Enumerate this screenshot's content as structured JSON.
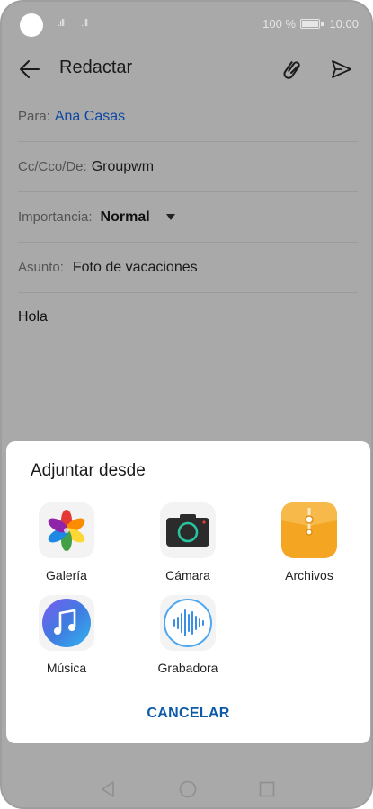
{
  "status_bar": {
    "signal1": ".ıll",
    "signal2": ".ıll",
    "battery": "100 %",
    "time": "10:00"
  },
  "app_bar": {
    "title": "Redactar",
    "icons": [
      "back-arrow-icon",
      "paperclip-icon",
      "send-icon"
    ]
  },
  "form": {
    "to_label": "Para:",
    "to_value": "Ana Casas",
    "cc_label": "Cc/Cco/De:",
    "cc_value": "Groupwm",
    "importance_label": "Importancia:",
    "importance_value": "Normal",
    "subject_label": "Asunto:",
    "subject_value": "Foto de vacaciones",
    "body": "Hola"
  },
  "sheet": {
    "title": "Adjuntar desde",
    "options": [
      {
        "label": "Galería",
        "icon": "gallery-icon"
      },
      {
        "label": "Cámara",
        "icon": "camera-icon"
      },
      {
        "label": "Archivos",
        "icon": "files-icon"
      },
      {
        "label": "Música",
        "icon": "music-icon"
      },
      {
        "label": "Grabadora",
        "icon": "recorder-icon"
      }
    ],
    "cancel_label": "CANCELAR"
  },
  "colors": {
    "accent": "#0d5aa7",
    "link": "#0d47a1",
    "scrim": "#a9a9a9"
  }
}
